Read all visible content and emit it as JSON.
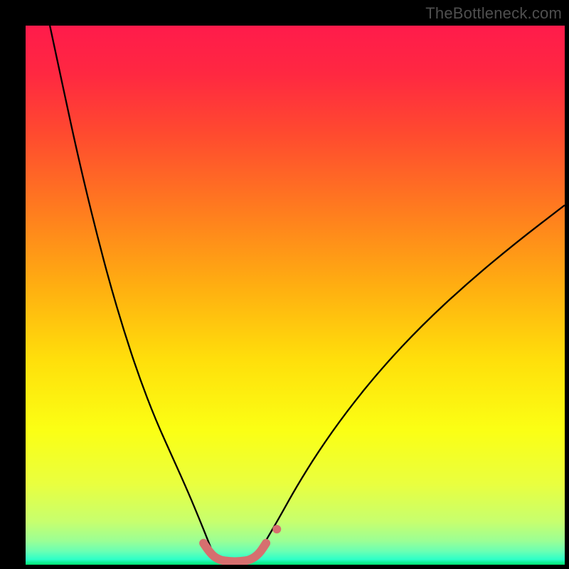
{
  "watermark": "TheBottleneck.com",
  "chart_data": {
    "type": "line",
    "title": "",
    "xlabel": "",
    "ylabel": "",
    "xlim": [
      0,
      100
    ],
    "ylim": [
      0,
      100
    ],
    "grid": false,
    "legend": false,
    "axis_visible": false,
    "background_gradient_stops": [
      {
        "offset": 0.0,
        "color": "#ff1b4b"
      },
      {
        "offset": 0.09,
        "color": "#ff2841"
      },
      {
        "offset": 0.2,
        "color": "#ff4a2f"
      },
      {
        "offset": 0.34,
        "color": "#ff7b1f"
      },
      {
        "offset": 0.48,
        "color": "#ffad11"
      },
      {
        "offset": 0.62,
        "color": "#ffdf0b"
      },
      {
        "offset": 0.75,
        "color": "#fbff14"
      },
      {
        "offset": 0.85,
        "color": "#e9ff3f"
      },
      {
        "offset": 0.92,
        "color": "#c7ff6e"
      },
      {
        "offset": 0.955,
        "color": "#9cff94"
      },
      {
        "offset": 0.975,
        "color": "#6affb3"
      },
      {
        "offset": 0.99,
        "color": "#2effc8"
      },
      {
        "offset": 1.0,
        "color": "#00e572"
      }
    ],
    "series": [
      {
        "name": "left-arm",
        "color": "#000000",
        "stroke_width": 2.3,
        "x": [
          4.5,
          6.0,
          7.6,
          9.3,
          11.2,
          13.3,
          15.6,
          18.2,
          21.0,
          24.1,
          27.5,
          30.3,
          32.3,
          33.7,
          34.5
        ],
        "y": [
          100,
          93.0,
          85.5,
          77.7,
          69.5,
          61.0,
          52.3,
          43.5,
          35.0,
          26.9,
          19.4,
          13.1,
          8.3,
          4.8,
          2.8
        ]
      },
      {
        "name": "right-arm",
        "color": "#000000",
        "stroke_width": 2.3,
        "x": [
          43.6,
          45.0,
          47.2,
          50.2,
          54.3,
          59.6,
          66.0,
          73.5,
          81.9,
          90.9,
          100.0
        ],
        "y": [
          2.8,
          5.2,
          9.0,
          14.4,
          21.0,
          28.5,
          36.4,
          44.4,
          52.2,
          59.7,
          66.7
        ]
      },
      {
        "name": "valley-highlight",
        "color": "#d66f6f",
        "stroke_width": 12,
        "stroke_linecap": "round",
        "x": [
          33.0,
          34.3,
          35.9,
          37.8,
          39.8,
          41.7,
          43.3,
          44.6
        ],
        "y": [
          4.0,
          2.0,
          0.9,
          0.6,
          0.6,
          0.9,
          2.0,
          4.0
        ]
      }
    ],
    "point": {
      "name": "valley-dot",
      "color": "#d66f6f",
      "radius": 6,
      "x": 46.6,
      "y": 6.6
    }
  }
}
